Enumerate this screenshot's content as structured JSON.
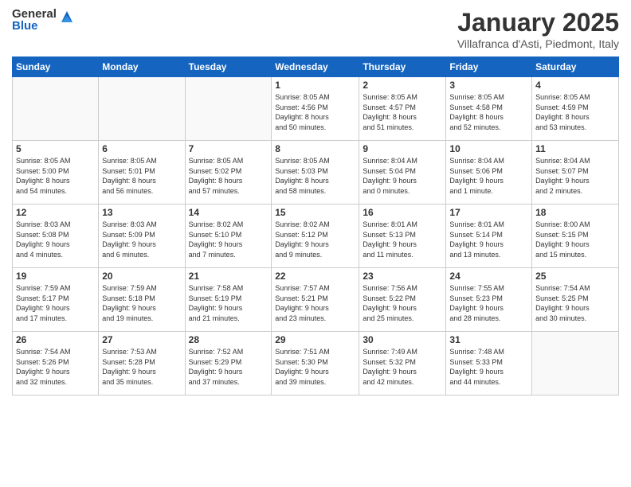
{
  "logo": {
    "general": "General",
    "blue": "Blue"
  },
  "header": {
    "month_year": "January 2025",
    "location": "Villafranca d'Asti, Piedmont, Italy"
  },
  "weekdays": [
    "Sunday",
    "Monday",
    "Tuesday",
    "Wednesday",
    "Thursday",
    "Friday",
    "Saturday"
  ],
  "weeks": [
    [
      {
        "day": "",
        "info": ""
      },
      {
        "day": "",
        "info": ""
      },
      {
        "day": "",
        "info": ""
      },
      {
        "day": "1",
        "info": "Sunrise: 8:05 AM\nSunset: 4:56 PM\nDaylight: 8 hours\nand 50 minutes."
      },
      {
        "day": "2",
        "info": "Sunrise: 8:05 AM\nSunset: 4:57 PM\nDaylight: 8 hours\nand 51 minutes."
      },
      {
        "day": "3",
        "info": "Sunrise: 8:05 AM\nSunset: 4:58 PM\nDaylight: 8 hours\nand 52 minutes."
      },
      {
        "day": "4",
        "info": "Sunrise: 8:05 AM\nSunset: 4:59 PM\nDaylight: 8 hours\nand 53 minutes."
      }
    ],
    [
      {
        "day": "5",
        "info": "Sunrise: 8:05 AM\nSunset: 5:00 PM\nDaylight: 8 hours\nand 54 minutes."
      },
      {
        "day": "6",
        "info": "Sunrise: 8:05 AM\nSunset: 5:01 PM\nDaylight: 8 hours\nand 56 minutes."
      },
      {
        "day": "7",
        "info": "Sunrise: 8:05 AM\nSunset: 5:02 PM\nDaylight: 8 hours\nand 57 minutes."
      },
      {
        "day": "8",
        "info": "Sunrise: 8:05 AM\nSunset: 5:03 PM\nDaylight: 8 hours\nand 58 minutes."
      },
      {
        "day": "9",
        "info": "Sunrise: 8:04 AM\nSunset: 5:04 PM\nDaylight: 9 hours\nand 0 minutes."
      },
      {
        "day": "10",
        "info": "Sunrise: 8:04 AM\nSunset: 5:06 PM\nDaylight: 9 hours\nand 1 minute."
      },
      {
        "day": "11",
        "info": "Sunrise: 8:04 AM\nSunset: 5:07 PM\nDaylight: 9 hours\nand 2 minutes."
      }
    ],
    [
      {
        "day": "12",
        "info": "Sunrise: 8:03 AM\nSunset: 5:08 PM\nDaylight: 9 hours\nand 4 minutes."
      },
      {
        "day": "13",
        "info": "Sunrise: 8:03 AM\nSunset: 5:09 PM\nDaylight: 9 hours\nand 6 minutes."
      },
      {
        "day": "14",
        "info": "Sunrise: 8:02 AM\nSunset: 5:10 PM\nDaylight: 9 hours\nand 7 minutes."
      },
      {
        "day": "15",
        "info": "Sunrise: 8:02 AM\nSunset: 5:12 PM\nDaylight: 9 hours\nand 9 minutes."
      },
      {
        "day": "16",
        "info": "Sunrise: 8:01 AM\nSunset: 5:13 PM\nDaylight: 9 hours\nand 11 minutes."
      },
      {
        "day": "17",
        "info": "Sunrise: 8:01 AM\nSunset: 5:14 PM\nDaylight: 9 hours\nand 13 minutes."
      },
      {
        "day": "18",
        "info": "Sunrise: 8:00 AM\nSunset: 5:15 PM\nDaylight: 9 hours\nand 15 minutes."
      }
    ],
    [
      {
        "day": "19",
        "info": "Sunrise: 7:59 AM\nSunset: 5:17 PM\nDaylight: 9 hours\nand 17 minutes."
      },
      {
        "day": "20",
        "info": "Sunrise: 7:59 AM\nSunset: 5:18 PM\nDaylight: 9 hours\nand 19 minutes."
      },
      {
        "day": "21",
        "info": "Sunrise: 7:58 AM\nSunset: 5:19 PM\nDaylight: 9 hours\nand 21 minutes."
      },
      {
        "day": "22",
        "info": "Sunrise: 7:57 AM\nSunset: 5:21 PM\nDaylight: 9 hours\nand 23 minutes."
      },
      {
        "day": "23",
        "info": "Sunrise: 7:56 AM\nSunset: 5:22 PM\nDaylight: 9 hours\nand 25 minutes."
      },
      {
        "day": "24",
        "info": "Sunrise: 7:55 AM\nSunset: 5:23 PM\nDaylight: 9 hours\nand 28 minutes."
      },
      {
        "day": "25",
        "info": "Sunrise: 7:54 AM\nSunset: 5:25 PM\nDaylight: 9 hours\nand 30 minutes."
      }
    ],
    [
      {
        "day": "26",
        "info": "Sunrise: 7:54 AM\nSunset: 5:26 PM\nDaylight: 9 hours\nand 32 minutes."
      },
      {
        "day": "27",
        "info": "Sunrise: 7:53 AM\nSunset: 5:28 PM\nDaylight: 9 hours\nand 35 minutes."
      },
      {
        "day": "28",
        "info": "Sunrise: 7:52 AM\nSunset: 5:29 PM\nDaylight: 9 hours\nand 37 minutes."
      },
      {
        "day": "29",
        "info": "Sunrise: 7:51 AM\nSunset: 5:30 PM\nDaylight: 9 hours\nand 39 minutes."
      },
      {
        "day": "30",
        "info": "Sunrise: 7:49 AM\nSunset: 5:32 PM\nDaylight: 9 hours\nand 42 minutes."
      },
      {
        "day": "31",
        "info": "Sunrise: 7:48 AM\nSunset: 5:33 PM\nDaylight: 9 hours\nand 44 minutes."
      },
      {
        "day": "",
        "info": ""
      }
    ]
  ]
}
